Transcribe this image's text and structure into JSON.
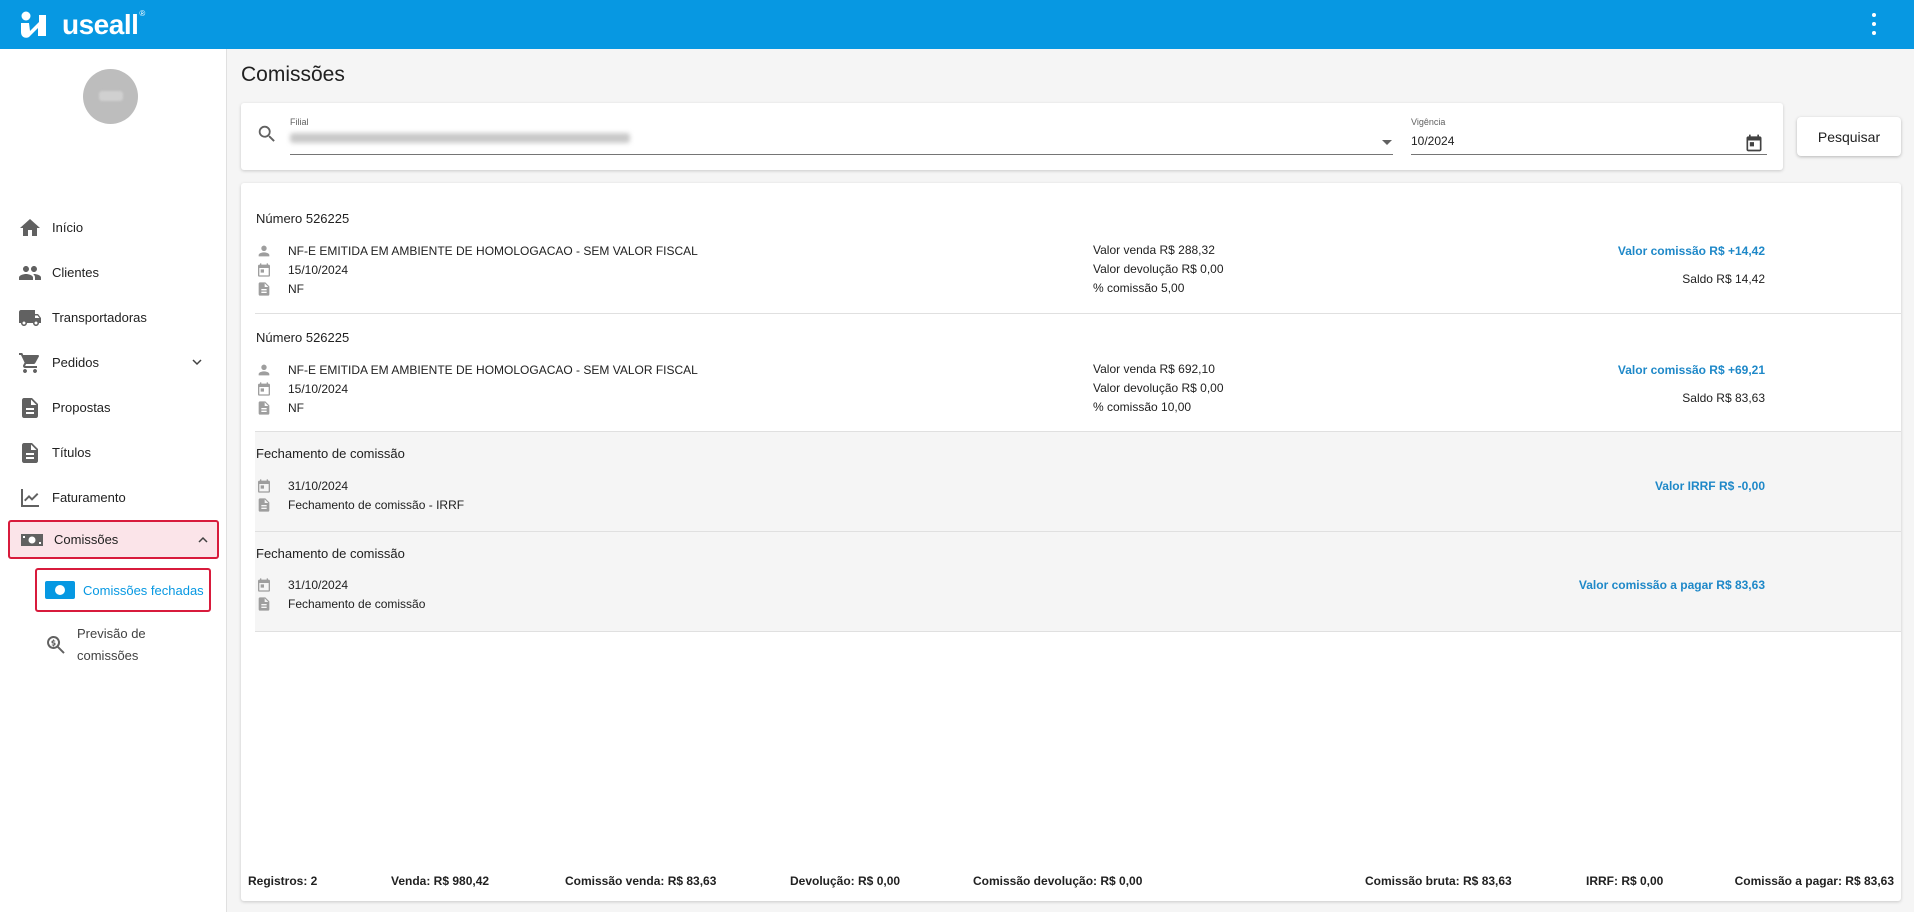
{
  "app": {
    "brand": "useall",
    "brand_mark": "®",
    "accent": "#0798e2",
    "highlight_border": "#d81b3c"
  },
  "sidebar": {
    "items": [
      {
        "label": "Início",
        "icon": "home-icon"
      },
      {
        "label": "Clientes",
        "icon": "people-icon"
      },
      {
        "label": "Transportadoras",
        "icon": "truck-icon"
      },
      {
        "label": "Pedidos",
        "icon": "cart-icon",
        "expandable": true
      },
      {
        "label": "Propostas",
        "icon": "document-icon"
      },
      {
        "label": "Títulos",
        "icon": "file-icon"
      },
      {
        "label": "Faturamento",
        "icon": "trending-icon"
      },
      {
        "label": "Comissões",
        "icon": "money-icon",
        "expanded": true
      }
    ],
    "subitems": [
      {
        "label": "Comissões fechadas",
        "icon": "money-icon",
        "selected": true
      },
      {
        "label": "Previsão de comissões",
        "icon": "search-money-icon"
      }
    ]
  },
  "page": {
    "title": "Comissões"
  },
  "filters": {
    "filial_label": "Filial",
    "vigencia_label": "Vigência",
    "vigencia_value": "10/2024",
    "search_button": "Pesquisar"
  },
  "entries": [
    {
      "title": "Número 526225",
      "desc": "NF-E EMITIDA EM AMBIENTE DE HOMOLOGACAO - SEM VALOR FISCAL",
      "date": "15/10/2024",
      "doc": "NF",
      "venda": "Valor venda R$ 288,32",
      "devolucao": "Valor devolução R$ 0,00",
      "percentual": "% comissão 5,00",
      "valor": "Valor comissão R$ +14,42",
      "saldo": "Saldo R$ 14,42"
    },
    {
      "title": "Número 526225",
      "desc": "NF-E EMITIDA EM AMBIENTE DE HOMOLOGACAO - SEM VALOR FISCAL",
      "date": "15/10/2024",
      "doc": "NF",
      "venda": "Valor venda R$ 692,10",
      "devolucao": "Valor devolução R$ 0,00",
      "percentual": "% comissão 10,00",
      "valor": "Valor comissão R$ +69,21",
      "saldo": "Saldo R$ 83,63"
    },
    {
      "title": "Fechamento de comissão",
      "date": "31/10/2024",
      "doc": "Fechamento de comissão - IRRF",
      "valor": "Valor IRRF R$ -0,00"
    },
    {
      "title": "Fechamento de comissão",
      "date": "31/10/2024",
      "doc": "Fechamento de comissão",
      "valor": "Valor comissão a pagar R$ 83,63"
    }
  ],
  "footer": {
    "registros": "Registros: 2",
    "venda": "Venda: R$ 980,42",
    "comissao_venda": "Comissão venda: R$ 83,63",
    "devolucao": "Devolução: R$ 0,00",
    "comissao_devolucao": "Comissão devolução: R$ 0,00",
    "comissao_bruta": "Comissão bruta: R$ 83,63",
    "irrf": "IRRF: R$ 0,00",
    "comissao_pagar": "Comissão a pagar: R$ 83,63"
  }
}
